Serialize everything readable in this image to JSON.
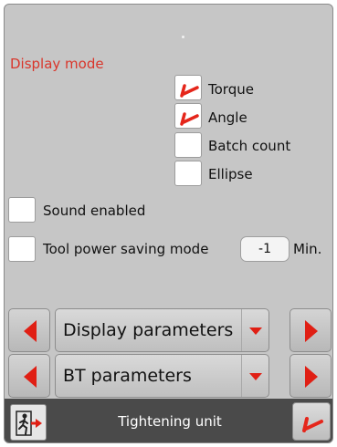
{
  "display_mode": {
    "title": "Display mode",
    "options": [
      {
        "label": "Torque",
        "checked": true
      },
      {
        "label": "Angle",
        "checked": true
      },
      {
        "label": "Batch count",
        "checked": false
      },
      {
        "label": "Ellipse",
        "checked": false
      }
    ]
  },
  "sound": {
    "label": "Sound enabled",
    "checked": false
  },
  "power_saving": {
    "label": "Tool power saving mode",
    "checked": false,
    "value": "-1",
    "unit": "Min."
  },
  "nav": {
    "display_params": "Display parameters",
    "bt_params": "BT parameters"
  },
  "footer": {
    "title": "Tightening unit"
  },
  "colors": {
    "accent_red": "#d9362b",
    "panel_gray": "#c6c6c6",
    "footer_dark": "#4a4a4a"
  },
  "icons": {
    "prev": "left-arrow-icon",
    "next": "right-arrow-icon",
    "dropdown": "chevron-down-icon",
    "exit": "exit-door-icon",
    "confirm": "checkmark-icon"
  }
}
